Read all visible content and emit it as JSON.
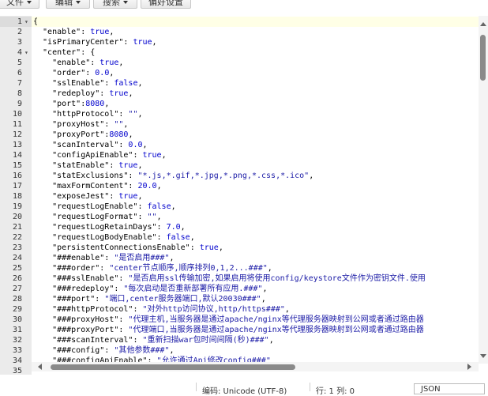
{
  "toolbar": {
    "buttons": [
      {
        "label": "文件"
      },
      {
        "label": "编辑"
      },
      {
        "label": "搜索"
      },
      {
        "label": "偏好设置"
      }
    ]
  },
  "editor": {
    "lines": [
      [
        {
          "t": "p",
          "v": "{"
        }
      ],
      [
        {
          "t": "k",
          "v": "  \"enable\""
        },
        {
          "t": "p",
          "v": ": "
        },
        {
          "t": "v",
          "v": "true"
        },
        {
          "t": "p",
          "v": ","
        }
      ],
      [
        {
          "t": "k",
          "v": "  \"isPrimaryCenter\""
        },
        {
          "t": "p",
          "v": ": "
        },
        {
          "t": "v",
          "v": "true"
        },
        {
          "t": "p",
          "v": ","
        }
      ],
      [
        {
          "t": "k",
          "v": "  \"center\""
        },
        {
          "t": "p",
          "v": ": {"
        }
      ],
      [
        {
          "t": "k",
          "v": "    \"enable\""
        },
        {
          "t": "p",
          "v": ": "
        },
        {
          "t": "v",
          "v": "true"
        },
        {
          "t": "p",
          "v": ","
        }
      ],
      [
        {
          "t": "k",
          "v": "    \"order\""
        },
        {
          "t": "p",
          "v": ": "
        },
        {
          "t": "v",
          "v": "0.0"
        },
        {
          "t": "p",
          "v": ","
        }
      ],
      [
        {
          "t": "k",
          "v": "    \"sslEnable\""
        },
        {
          "t": "p",
          "v": ": "
        },
        {
          "t": "v",
          "v": "false"
        },
        {
          "t": "p",
          "v": ","
        }
      ],
      [
        {
          "t": "k",
          "v": "    \"redeploy\""
        },
        {
          "t": "p",
          "v": ": "
        },
        {
          "t": "v",
          "v": "true"
        },
        {
          "t": "p",
          "v": ","
        }
      ],
      [
        {
          "t": "k",
          "v": "    \"port\""
        },
        {
          "t": "p",
          "v": ":"
        },
        {
          "t": "v",
          "v": "8080"
        },
        {
          "t": "p",
          "v": ","
        }
      ],
      [
        {
          "t": "k",
          "v": "    \"httpProtocol\""
        },
        {
          "t": "p",
          "v": ": "
        },
        {
          "t": "s",
          "v": "\"\""
        },
        {
          "t": "p",
          "v": ","
        }
      ],
      [
        {
          "t": "k",
          "v": "    \"proxyHost\""
        },
        {
          "t": "p",
          "v": ": "
        },
        {
          "t": "s",
          "v": "\"\""
        },
        {
          "t": "p",
          "v": ","
        }
      ],
      [
        {
          "t": "k",
          "v": "    \"proxyPort\""
        },
        {
          "t": "p",
          "v": ":"
        },
        {
          "t": "v",
          "v": "8080"
        },
        {
          "t": "p",
          "v": ","
        }
      ],
      [
        {
          "t": "k",
          "v": "    \"scanInterval\""
        },
        {
          "t": "p",
          "v": ": "
        },
        {
          "t": "v",
          "v": "0.0"
        },
        {
          "t": "p",
          "v": ","
        }
      ],
      [
        {
          "t": "k",
          "v": "    \"configApiEnable\""
        },
        {
          "t": "p",
          "v": ": "
        },
        {
          "t": "v",
          "v": "true"
        },
        {
          "t": "p",
          "v": ","
        }
      ],
      [
        {
          "t": "k",
          "v": "    \"statEnable\""
        },
        {
          "t": "p",
          "v": ": "
        },
        {
          "t": "v",
          "v": "true"
        },
        {
          "t": "p",
          "v": ","
        }
      ],
      [
        {
          "t": "k",
          "v": "    \"statExclusions\""
        },
        {
          "t": "p",
          "v": ": "
        },
        {
          "t": "s",
          "v": "\"*.js,*.gif,*.jpg,*.png,*.css,*.ico\""
        },
        {
          "t": "p",
          "v": ","
        }
      ],
      [
        {
          "t": "k",
          "v": "    \"maxFormContent\""
        },
        {
          "t": "p",
          "v": ": "
        },
        {
          "t": "v",
          "v": "20.0"
        },
        {
          "t": "p",
          "v": ","
        }
      ],
      [
        {
          "t": "k",
          "v": "    \"exposeJest\""
        },
        {
          "t": "p",
          "v": ": "
        },
        {
          "t": "v",
          "v": "true"
        },
        {
          "t": "p",
          "v": ","
        }
      ],
      [
        {
          "t": "k",
          "v": "    \"requestLogEnable\""
        },
        {
          "t": "p",
          "v": ": "
        },
        {
          "t": "v",
          "v": "false"
        },
        {
          "t": "p",
          "v": ","
        }
      ],
      [
        {
          "t": "k",
          "v": "    \"requestLogFormat\""
        },
        {
          "t": "p",
          "v": ": "
        },
        {
          "t": "s",
          "v": "\"\""
        },
        {
          "t": "p",
          "v": ","
        }
      ],
      [
        {
          "t": "k",
          "v": "    \"requestLogRetainDays\""
        },
        {
          "t": "p",
          "v": ": "
        },
        {
          "t": "v",
          "v": "7.0"
        },
        {
          "t": "p",
          "v": ","
        }
      ],
      [
        {
          "t": "k",
          "v": "    \"requestLogBodyEnable\""
        },
        {
          "t": "p",
          "v": ": "
        },
        {
          "t": "v",
          "v": "false"
        },
        {
          "t": "p",
          "v": ","
        }
      ],
      [
        {
          "t": "k",
          "v": "    \"persistentConnectionsEnable\""
        },
        {
          "t": "p",
          "v": ": "
        },
        {
          "t": "v",
          "v": "true"
        },
        {
          "t": "p",
          "v": ","
        }
      ],
      [
        {
          "t": "k",
          "v": "    \"###enable\""
        },
        {
          "t": "p",
          "v": ": "
        },
        {
          "t": "s",
          "v": "\"是否启用###\""
        },
        {
          "t": "p",
          "v": ","
        }
      ],
      [
        {
          "t": "k",
          "v": "    \"###order\""
        },
        {
          "t": "p",
          "v": ": "
        },
        {
          "t": "s",
          "v": "\"center节点顺序,顺序排列0,1,2...###\""
        },
        {
          "t": "p",
          "v": ","
        }
      ],
      [
        {
          "t": "k",
          "v": "    \"###sslEnable\""
        },
        {
          "t": "p",
          "v": ": "
        },
        {
          "t": "s",
          "v": "\"是否启用ssl传输加密,如果启用将使用config/keystore文件作为密钥文件.使用"
        }
      ],
      [
        {
          "t": "k",
          "v": "    \"###redeploy\""
        },
        {
          "t": "p",
          "v": ": "
        },
        {
          "t": "s",
          "v": "\"每次启动是否重新部署所有应用.###\""
        },
        {
          "t": "p",
          "v": ","
        }
      ],
      [
        {
          "t": "k",
          "v": "    \"###port\""
        },
        {
          "t": "p",
          "v": ": "
        },
        {
          "t": "s",
          "v": "\"端口,center服务器端口,默认20030###\""
        },
        {
          "t": "p",
          "v": ","
        }
      ],
      [
        {
          "t": "k",
          "v": "    \"###httpProtocol\""
        },
        {
          "t": "p",
          "v": ": "
        },
        {
          "t": "s",
          "v": "\"对外http访问协议,http/https###\""
        },
        {
          "t": "p",
          "v": ","
        }
      ],
      [
        {
          "t": "k",
          "v": "    \"###proxyHost\""
        },
        {
          "t": "p",
          "v": ": "
        },
        {
          "t": "s",
          "v": "\"代理主机,当服务器是通过apache/nginx等代理服务器映射到公网或者通过路由器"
        }
      ],
      [
        {
          "t": "k",
          "v": "    \"###proxyPort\""
        },
        {
          "t": "p",
          "v": ": "
        },
        {
          "t": "s",
          "v": "\"代理端口,当服务器是通过apache/nginx等代理服务器映射到公网或者通过路由器"
        }
      ],
      [
        {
          "t": "k",
          "v": "    \"###scanInterval\""
        },
        {
          "t": "p",
          "v": ": "
        },
        {
          "t": "s",
          "v": "\"重新扫描war包时间间隔(秒)###\""
        },
        {
          "t": "p",
          "v": ","
        }
      ],
      [
        {
          "t": "k",
          "v": "    \"###config\""
        },
        {
          "t": "p",
          "v": ": "
        },
        {
          "t": "s",
          "v": "\"其他参数###\""
        },
        {
          "t": "p",
          "v": ","
        }
      ],
      [
        {
          "t": "k",
          "v": "    \"###configApiEnable\""
        },
        {
          "t": "p",
          "v": ": "
        },
        {
          "t": "s",
          "v": "\"允许通过Api修改config###\""
        }
      ],
      []
    ],
    "fold_marker_lines": [
      1,
      4
    ]
  },
  "statusbar": {
    "encoding": "编码: Unicode (UTF-8)",
    "cursor": "行: 1  列: 0",
    "language": "JSON"
  },
  "colors": {
    "string": "#1a1aa6",
    "value": "#0000cd",
    "gutter": "#ebebeb",
    "active_line": "#ffffe6"
  }
}
